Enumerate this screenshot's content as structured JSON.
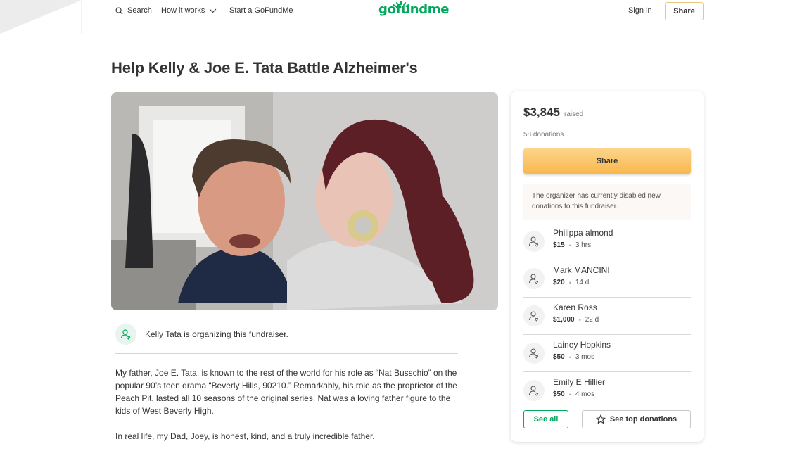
{
  "header": {
    "search_label": "Search",
    "how_label": "How it works",
    "start_label": "Start a GoFundMe",
    "logo_text": "gofundme",
    "signin_label": "Sign in",
    "share_label": "Share"
  },
  "campaign": {
    "title": "Help Kelly & Joe E. Tata Battle Alzheimer's",
    "organizer_text": "Kelly Tata is organizing this fundraiser.",
    "story": [
      "My father, Joe E. Tata, is known to the rest of the world for his role as “Nat Busschio” on the popular 90’s teen drama “Beverly Hills, 90210.” Remarkably, his role as the proprietor of the Peach Pit, lasted all 10 seasons of the original series. Nat was a loving father figure to the kids of West Beverly High.",
      "In real life, my Dad, Joey, is honest, kind, and a truly incredible father."
    ]
  },
  "sidebar": {
    "raised_amount": "$3,845",
    "raised_label": "raised",
    "donations_count": "58 donations",
    "share_label": "Share",
    "notice": "The organizer has currently disabled new donations to this fundraiser.",
    "donors": [
      {
        "name": "Philippa almond",
        "amount": "$15",
        "time": "3 hrs"
      },
      {
        "name": "Mark MANCINI",
        "amount": "$20",
        "time": "14 d"
      },
      {
        "name": "Karen Ross",
        "amount": "$1,000",
        "time": "22 d"
      },
      {
        "name": "Lainey Hopkins",
        "amount": "$50",
        "time": "3 mos"
      },
      {
        "name": "Emily E Hillier",
        "amount": "$50",
        "time": "4 mos"
      }
    ],
    "see_all_label": "See all",
    "see_top_label": "See top donations"
  },
  "colors": {
    "brand": "#02a95c",
    "share_button": "#f8b84e"
  }
}
